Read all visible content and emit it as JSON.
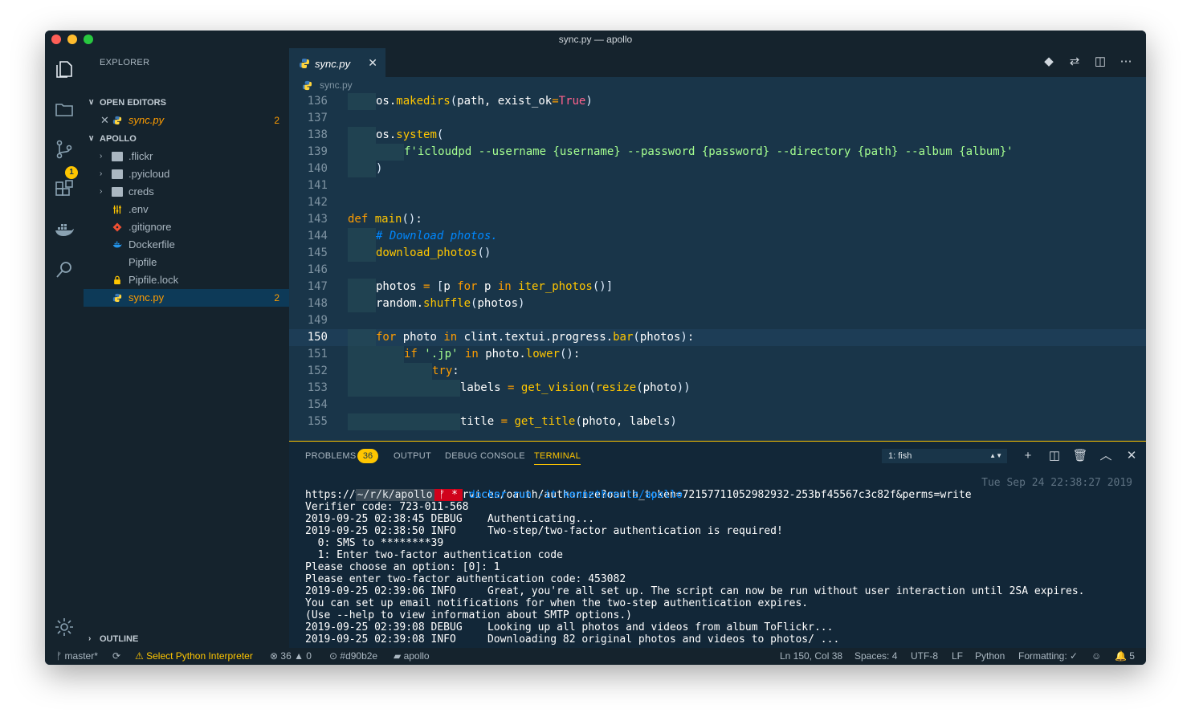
{
  "window": {
    "title": "sync.py — apollo"
  },
  "activity": {
    "items": [
      "explorer-icon",
      "folder-icon",
      "source-control-icon",
      "extensions-icon",
      "docker-icon",
      "search-icon",
      "gear-icon"
    ],
    "scm_badge": "1"
  },
  "sidebar": {
    "title": "EXPLORER",
    "open_editors_label": "OPEN EDITORS",
    "open_editors": [
      {
        "name": "sync.py",
        "count": "2"
      }
    ],
    "folder_label": "APOLLO",
    "files": [
      {
        "name": ".flickr",
        "type": "folder"
      },
      {
        "name": ".pyicloud",
        "type": "folder"
      },
      {
        "name": "creds",
        "type": "folder"
      },
      {
        "name": ".env",
        "type": "env"
      },
      {
        "name": ".gitignore",
        "type": "git"
      },
      {
        "name": "Dockerfile",
        "type": "docker"
      },
      {
        "name": "Pipfile",
        "type": "file"
      },
      {
        "name": "Pipfile.lock",
        "type": "lock"
      },
      {
        "name": "sync.py",
        "type": "python",
        "count": "2"
      }
    ],
    "outline_label": "OUTLINE"
  },
  "editor": {
    "tab": {
      "name": "sync.py"
    },
    "breadcrumb": "sync.py",
    "lines": [
      {
        "n": "136",
        "indent": 1,
        "html": "os.makedirs(path, exist_ok=True)"
      },
      {
        "n": "137",
        "indent": 0,
        "html": ""
      },
      {
        "n": "138",
        "indent": 1,
        "html": "os.system("
      },
      {
        "n": "139",
        "indent": 2,
        "html": "f'icloudpd --username {username} --password {password} --directory {path} --album {album}'"
      },
      {
        "n": "140",
        "indent": 1,
        "html": ")"
      },
      {
        "n": "141",
        "indent": 0,
        "html": ""
      },
      {
        "n": "142",
        "indent": 0,
        "html": ""
      },
      {
        "n": "143",
        "indent": 0,
        "html": "def main():"
      },
      {
        "n": "144",
        "indent": 1,
        "html": "# Download photos."
      },
      {
        "n": "145",
        "indent": 1,
        "html": "download_photos()"
      },
      {
        "n": "146",
        "indent": 0,
        "html": ""
      },
      {
        "n": "147",
        "indent": 1,
        "html": "photos = [p for p in iter_photos()]"
      },
      {
        "n": "148",
        "indent": 1,
        "html": "random.shuffle(photos)"
      },
      {
        "n": "149",
        "indent": 0,
        "html": ""
      },
      {
        "n": "150",
        "indent": 1,
        "html": "for photo in clint.textui.progress.bar(photos):"
      },
      {
        "n": "151",
        "indent": 2,
        "html": "if '.jp' in photo.lower():"
      },
      {
        "n": "152",
        "indent": 3,
        "html": "try:"
      },
      {
        "n": "153",
        "indent": 4,
        "html": "labels = get_vision(resize(photo))"
      },
      {
        "n": "154",
        "indent": 0,
        "html": ""
      },
      {
        "n": "155",
        "indent": 4,
        "html": "title = get_title(photo, labels)"
      }
    ]
  },
  "panel": {
    "tabs": [
      "PROBLEMS",
      "OUTPUT",
      "DEBUG CONSOLE",
      "TERMINAL"
    ],
    "problems_count": "36",
    "terminal_select": "1: fish",
    "prompt": {
      "path": "~/r/k/apollo",
      "git": "ᚠ *",
      "command": "docker run -it kennethreitz/apollo",
      "time": "Tue Sep 24 22:38:27 2019"
    },
    "output": [
      "https://www.flickr.com/services/oauth/authorize?oauth_token=72157711052982932-253bf45567c3c82f&perms=write",
      "Verifier code: 723-011-568",
      "2019-09-25 02:38:45 DEBUG    Authenticating...",
      "2019-09-25 02:38:50 INFO     Two-step/two-factor authentication is required!",
      "  0: SMS to ********39",
      "  1: Enter two-factor authentication code",
      "Please choose an option: [0]: 1",
      "Please enter two-factor authentication code: 453082",
      "2019-09-25 02:39:06 INFO     Great, you're all set up. The script can now be run without user interaction until 2SA expires.",
      "You can set up email notifications for when the two-step authentication expires.",
      "(Use --help to view information about SMTP options.)",
      "2019-09-25 02:39:08 DEBUG    Looking up all photos and videos from album ToFlickr...",
      "2019-09-25 02:39:08 INFO     Downloading 82 original photos and videos to photos/ ..."
    ]
  },
  "status": {
    "branch": "master*",
    "interpreter": "Select Python Interpreter",
    "errors": "36",
    "warnings": "0",
    "commit": "#d90b2e",
    "folder": "apollo",
    "position": "Ln 150, Col 38",
    "spaces": "Spaces: 4",
    "encoding": "UTF-8",
    "eol": "LF",
    "language": "Python",
    "formatting": "Formatting: ✓",
    "notifications": "5"
  },
  "colors": {
    "background": "#193549",
    "sidebar": "#15232d",
    "accent": "#ffc600",
    "keyword": "#ff9d00",
    "string": "#a5ff90",
    "comment": "#0088ff"
  }
}
